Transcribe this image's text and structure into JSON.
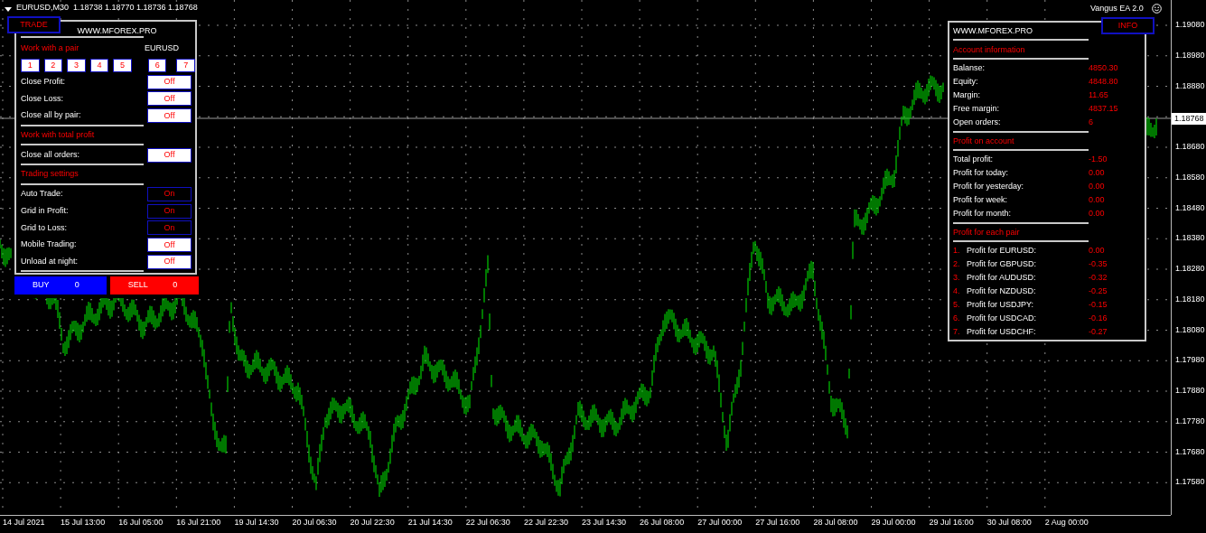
{
  "chart": {
    "symbol_line": "EURUSD,M30  1.18738 1.18770 1.18736 1.18768",
    "ea_label": "Vangus EA 2.0",
    "current_price": "1.18768",
    "price_axis_upper": [
      "1.19080",
      "1.18980",
      "1.18880"
    ],
    "price_axis_lower": [
      "1.18680",
      "1.18580",
      "1.18480",
      "1.18380",
      "1.18280",
      "1.18180",
      "1.18080",
      "1.17980",
      "1.17880",
      "1.17780",
      "1.17680",
      "1.17580"
    ],
    "time_axis": [
      "14 Jul 2021",
      "15 Jul 13:00",
      "16 Jul 05:00",
      "16 Jul 21:00",
      "19 Jul 14:30",
      "20 Jul 06:30",
      "20 Jul 22:30",
      "21 Jul 14:30",
      "22 Jul 06:30",
      "22 Jul 22:30",
      "23 Jul 14:30",
      "26 Jul 08:00",
      "27 Jul 00:00",
      "27 Jul 16:00",
      "28 Jul 08:00",
      "29 Jul 00:00",
      "29 Jul 16:00",
      "30 Jul 08:00",
      "2 Aug 00:00"
    ]
  },
  "trade_panel": {
    "tab": "TRADE",
    "title": "WWW.MFOREX.PRO",
    "items": [
      {
        "kind": "section",
        "label": "Work with a pair",
        "value": "EURUSD"
      },
      {
        "kind": "pair_buttons",
        "buttons": [
          "1",
          "2",
          "3",
          "4",
          "5",
          "6",
          "7"
        ]
      },
      {
        "kind": "toggle",
        "label": "Close Profit:",
        "value": "Off",
        "on": false
      },
      {
        "kind": "toggle",
        "label": "Close Loss:",
        "value": "Off",
        "on": false
      },
      {
        "kind": "toggle",
        "label": "Close all by pair:",
        "value": "Off",
        "on": false
      },
      {
        "kind": "divider"
      },
      {
        "kind": "section",
        "label": "Work with total profit"
      },
      {
        "kind": "divider"
      },
      {
        "kind": "toggle",
        "label": "Close all orders:",
        "value": "Off",
        "on": false
      },
      {
        "kind": "divider"
      },
      {
        "kind": "section",
        "label": "Trading settings"
      },
      {
        "kind": "divider"
      },
      {
        "kind": "toggle",
        "label": "Auto Trade:",
        "value": "On",
        "on": true
      },
      {
        "kind": "toggle",
        "label": "Grid in Profit:",
        "value": "On",
        "on": true
      },
      {
        "kind": "toggle",
        "label": "Grid to Loss:",
        "value": "On",
        "on": true
      },
      {
        "kind": "toggle",
        "label": "Mobile Trading:",
        "value": "Off",
        "on": false
      },
      {
        "kind": "toggle",
        "label": "Unload at night:",
        "value": "Off",
        "on": false
      },
      {
        "kind": "divider"
      }
    ],
    "buy": {
      "label": "BUY",
      "count": "0"
    },
    "sell": {
      "label": "SELL",
      "count": "0"
    }
  },
  "info_panel": {
    "tab": "INFO",
    "title": "WWW.MFOREX.PRO",
    "sections": [
      {
        "heading": "Account information",
        "rows": [
          {
            "label": "Balanse:",
            "value": "4850.30"
          },
          {
            "label": "Equity:",
            "value": "4848.80"
          },
          {
            "label": "Margin:",
            "value": "11.65"
          },
          {
            "label": "Free margin:",
            "value": "4837.15"
          },
          {
            "label": "Open orders:",
            "value": "6"
          }
        ]
      },
      {
        "heading": "Profit on account",
        "rows": [
          {
            "label": "Total profit:",
            "value": "-1.50"
          },
          {
            "label": "Profit for today:",
            "value": "0.00"
          },
          {
            "label": "Profit for yesterday:",
            "value": "0.00"
          },
          {
            "label": "Profit for week:",
            "value": "0.00"
          },
          {
            "label": "Profit for month:",
            "value": "0.00"
          }
        ]
      },
      {
        "heading": "Profit for each pair",
        "rows": [
          {
            "number": "1.",
            "label": "Profit for EURUSD:",
            "value": "0.00"
          },
          {
            "number": "2.",
            "label": "Profit for GBPUSD:",
            "value": "-0.35"
          },
          {
            "number": "3.",
            "label": "Profit for AUDUSD:",
            "value": "-0.32"
          },
          {
            "number": "4.",
            "label": "Profit for NZDUSD:",
            "value": "-0.25"
          },
          {
            "number": "5.",
            "label": "Profit for USDJPY:",
            "value": "-0.15"
          },
          {
            "number": "6.",
            "label": "Profit for USDCAD:",
            "value": "-0.16"
          },
          {
            "number": "7.",
            "label": "Profit for USDCHF:",
            "value": "-0.27"
          }
        ]
      }
    ]
  }
}
